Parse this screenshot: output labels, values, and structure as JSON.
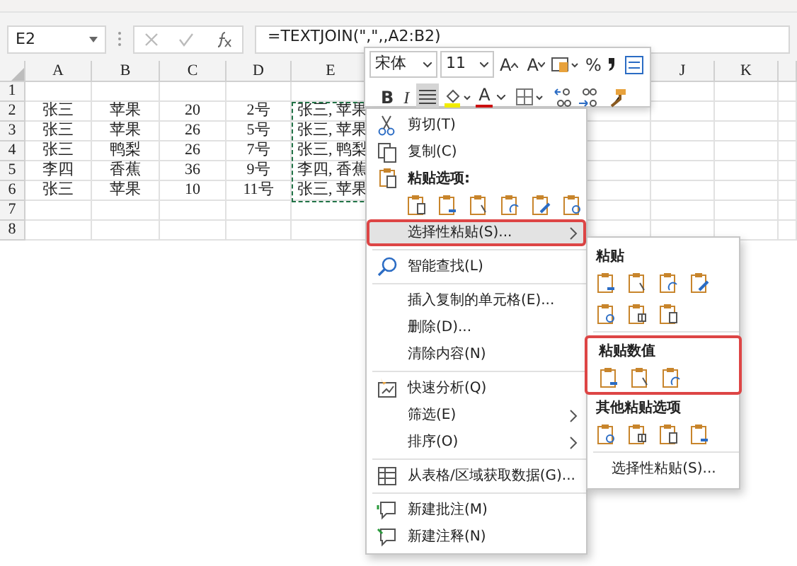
{
  "name_box": "E2",
  "formula": "=TEXTJOIN(\",\",,A2:B2)",
  "columns": [
    "A",
    "B",
    "C",
    "D",
    "E",
    "J",
    "K"
  ],
  "copy_marquee": true,
  "rows": [
    {
      "number": "1"
    },
    {
      "number": "2",
      "cells": [
        "张三",
        "苹果",
        "20",
        "2号",
        "张三, 苹果"
      ]
    },
    {
      "number": "3",
      "cells": [
        "张三",
        "苹果",
        "26",
        "5号",
        "张三, 苹果"
      ]
    },
    {
      "number": "4",
      "cells": [
        "张三",
        "鸭梨",
        "26",
        "7号",
        "张三, 鸭梨"
      ]
    },
    {
      "number": "5",
      "cells": [
        "李四",
        "香蕉",
        "36",
        "9号",
        "李四, 香蕉"
      ]
    },
    {
      "number": "6",
      "cells": [
        "张三",
        "苹果",
        "10",
        "11号",
        "张三, 苹果"
      ]
    },
    {
      "number": "7"
    },
    {
      "number": "8"
    }
  ],
  "mini_toolbar": {
    "font": "宋体",
    "size": "11",
    "grow_font": "A",
    "shrink_font": "A",
    "percent": "%",
    "bold": "B",
    "italic": "I",
    "font_color": "A",
    "align_selected": true
  },
  "context_menu": [
    {
      "kind": "command",
      "label": "剪切(T)",
      "icon": true
    },
    {
      "kind": "command",
      "label": "复制(C)",
      "icon": true
    },
    {
      "kind": "heading",
      "label": "粘贴选项:",
      "icon": true
    },
    {
      "kind": "options",
      "options": [
        {
          "kind": "clipboard"
        },
        {
          "kind": "clipboard"
        },
        {
          "kind": "clipboard"
        },
        {
          "kind": "clipboard"
        },
        {
          "kind": "clipboard"
        },
        {
          "kind": "clipboard"
        }
      ]
    },
    {
      "kind": "command",
      "label": "选择性粘贴(S)...",
      "submenu": true,
      "highlighted": true,
      "outlined": true
    },
    {
      "kind": "separator"
    },
    {
      "kind": "command",
      "label": "智能查找(L)",
      "icon": true
    },
    {
      "kind": "separator"
    },
    {
      "kind": "command",
      "label": "插入复制的单元格(E)..."
    },
    {
      "kind": "command",
      "label": "删除(D)..."
    },
    {
      "kind": "command",
      "label": "清除内容(N)"
    },
    {
      "kind": "separator"
    },
    {
      "kind": "command",
      "label": "快速分析(Q)",
      "icon": true
    },
    {
      "kind": "command",
      "label": "筛选(E)",
      "submenu": true
    },
    {
      "kind": "command",
      "label": "排序(O)",
      "submenu": true
    },
    {
      "kind": "separator"
    },
    {
      "kind": "command",
      "label": "从表格/区域获取数据(G)...",
      "icon": true
    },
    {
      "kind": "separator"
    },
    {
      "kind": "command",
      "label": "新建批注(M)",
      "icon": true
    },
    {
      "kind": "command",
      "label": "新建注释(N)",
      "icon": true
    }
  ],
  "submenu": [
    {
      "kind": "heading",
      "label": "粘贴"
    },
    {
      "kind": "options",
      "options": [
        {
          "kind": "clipboard"
        },
        {
          "kind": "clipboard"
        },
        {
          "kind": "clipboard"
        },
        {
          "kind": "clipboard"
        },
        {
          "kind": "clipboard"
        },
        {
          "kind": "clipboard"
        },
        {
          "kind": "clipboard"
        }
      ]
    },
    {
      "kind": "separator"
    },
    {
      "kind": "group",
      "outlined": true,
      "items": [
        {
          "kind": "heading",
          "label": "粘贴数值"
        },
        {
          "kind": "options",
          "options": [
            {
              "kind": "clipboard"
            },
            {
              "kind": "clipboard"
            },
            {
              "kind": "clipboard"
            }
          ]
        }
      ]
    },
    {
      "kind": "heading",
      "label": "其他粘贴选项"
    },
    {
      "kind": "options",
      "options": [
        {
          "kind": "clipboard"
        },
        {
          "kind": "clipboard"
        },
        {
          "kind": "clipboard"
        },
        {
          "kind": "clipboard"
        }
      ]
    },
    {
      "kind": "separator"
    },
    {
      "kind": "command",
      "label": "选择性粘贴(S)...",
      "center": true
    }
  ]
}
